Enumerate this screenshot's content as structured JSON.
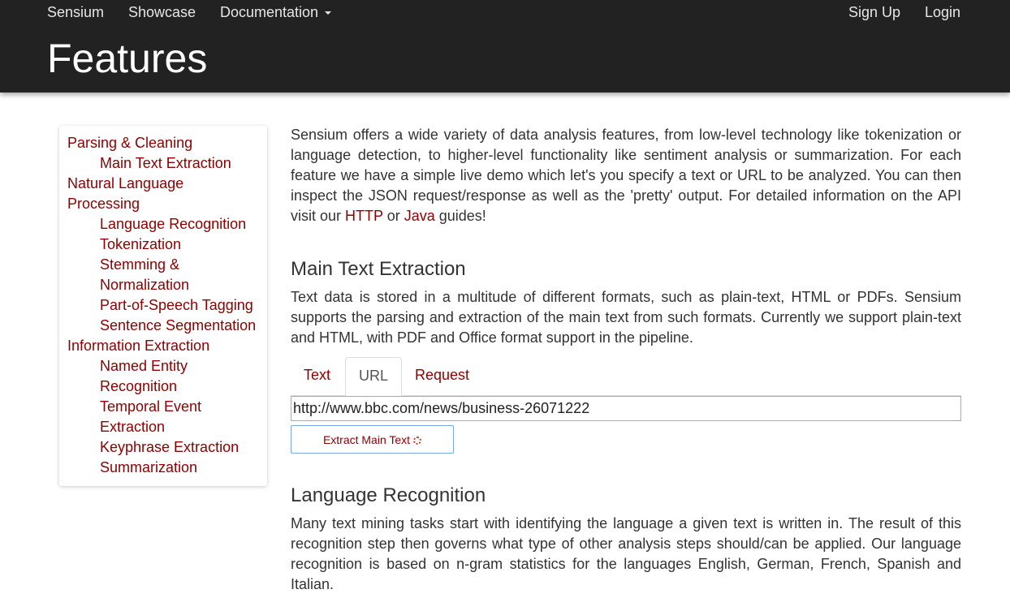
{
  "nav": {
    "brand": "Sensium",
    "showcase": "Showcase",
    "documentation": "Documentation",
    "signup": "Sign Up",
    "login": "Login"
  },
  "page": {
    "title": "Features"
  },
  "sidebar": {
    "items": [
      {
        "label": "Parsing & Cleaning",
        "level": 0
      },
      {
        "label": "Main Text Extraction",
        "level": 1
      },
      {
        "label": "Natural Language Processing",
        "level": 0
      },
      {
        "label": "Language Recognition",
        "level": 1
      },
      {
        "label": "Tokenization",
        "level": 1
      },
      {
        "label": "Stemming & Normalization",
        "level": 1
      },
      {
        "label": "Part-of-Speech Tagging",
        "level": 1
      },
      {
        "label": "Sentence Segmentation",
        "level": 1
      },
      {
        "label": "Information Extraction",
        "level": 0
      },
      {
        "label": "Named Entity Recognition",
        "level": 1
      },
      {
        "label": "Temporal Event Extraction",
        "level": 1
      },
      {
        "label": "Keyphrase Extraction",
        "level": 1
      },
      {
        "label": "Summarization",
        "level": 1
      }
    ]
  },
  "intro": {
    "text_before": "Sensium offers a wide variety of data analysis features, from low-level technology like tokenization or language detection, to higher-level functionality like sentiment analysis or summarization. For each feature we have a simple live demo which let's you specify a text or URL to be analyzed. You can then inspect the JSON request/response as well as the 'pretty' output. For detailed information on the API visit our ",
    "http_link": "HTTP",
    "or": " or ",
    "java_link": "Java",
    "text_after": " guides!"
  },
  "main_text_extraction": {
    "heading": "Main Text Extraction",
    "description": "Text data is stored in a multitude of different formats, such as plain-text, HTML or PDFs. Sensium supports the parsing and extraction of the main text from such formats. Currently we support plain-text and HTML, with PDF and Office format support in the pipeline.",
    "tabs": [
      {
        "label": "Text",
        "active": false
      },
      {
        "label": "URL",
        "active": true
      },
      {
        "label": "Request",
        "active": false
      }
    ],
    "url_value": "http://www.bbc.com/news/business-26071222",
    "button_label": "Extract Main Text"
  },
  "language_recognition": {
    "heading": "Language Recognition",
    "description": "Many text mining tasks start with identifying the language a given text is written in. The result of this recognition step then governs what type of other analysis steps should/can be applied. Our language recognition is based on n-gram statistics for the languages English, German, French, Spanish and Italian."
  },
  "colors": {
    "header_bg": "#222222",
    "link": "#8b0000",
    "text": "#333333"
  }
}
